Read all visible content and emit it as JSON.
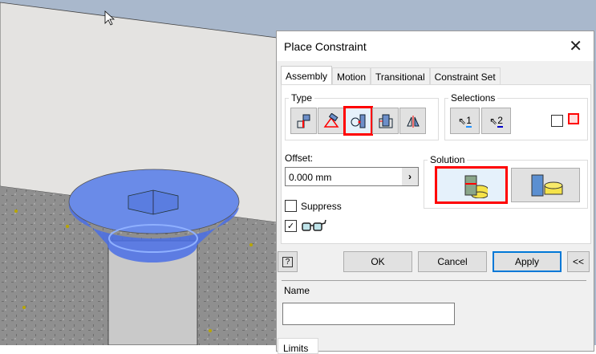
{
  "dialog": {
    "title": "Place Constraint",
    "tabs": [
      "Assembly",
      "Motion",
      "Transitional",
      "Constraint Set"
    ],
    "type_label": "Type",
    "selections_label": "Selections",
    "sel1": "1",
    "sel2": "2",
    "offset_label": "Offset:",
    "offset_value": "0.000 mm",
    "solution_label": "Solution",
    "suppress_label": "Suppress",
    "ok": "OK",
    "cancel": "Cancel",
    "apply": "Apply",
    "collapse": "<<",
    "help": "?",
    "name_label": "Name",
    "name_value": "",
    "limits_tab": "Limits"
  },
  "colors": {
    "highlight": "#ff0000",
    "accent": "#0078d7"
  }
}
